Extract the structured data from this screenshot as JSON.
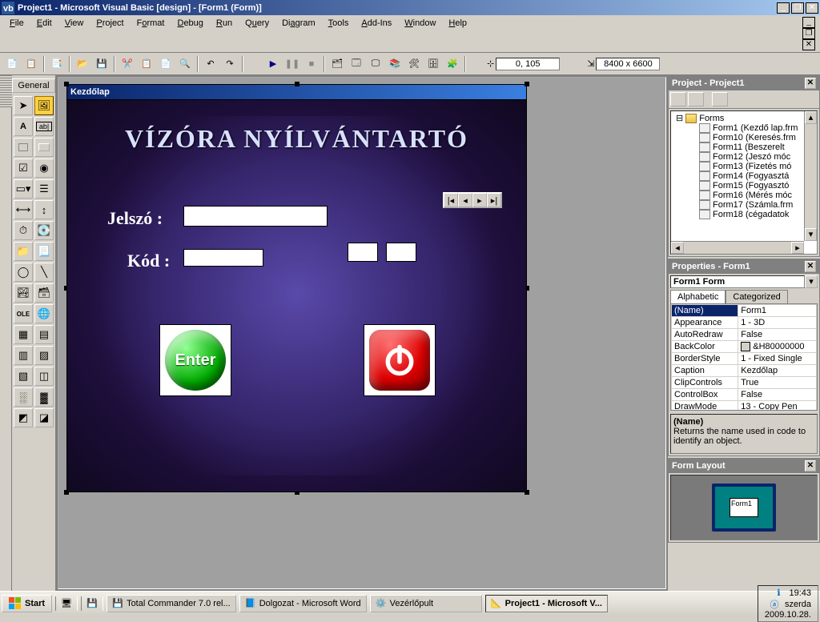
{
  "window": {
    "title": "Project1 - Microsoft Visual Basic [design] - [Form1 (Form)]"
  },
  "menubar": [
    "File",
    "Edit",
    "View",
    "Project",
    "Format",
    "Debug",
    "Run",
    "Query",
    "Diagram",
    "Tools",
    "Add-Ins",
    "Window",
    "Help"
  ],
  "coords": "0, 105",
  "dims": "8400 x 6600",
  "toolbox": {
    "header": "General"
  },
  "form": {
    "caption": "Kezdőlap",
    "title": "VÍZÓRA NYÍLVÁNTARTÓ",
    "label_password": "Jelszó :",
    "label_code": "Kód :",
    "enter": "Enter"
  },
  "project": {
    "title": "Project - Project1",
    "rootFolder": "Forms",
    "items": [
      "Form1 (Kezdő lap.frm",
      "Form10 (Keresés.frm",
      "Form11 (Beszerelt",
      "Form12 (Jeszó móc",
      "Form13 (Fizetés mó",
      "Form14 (Fogyasztá",
      "Form15 (Fogyasztó",
      "Form16 (Mérés móc",
      "Form17 (Számla.frm",
      "Form18 (cégadatok"
    ]
  },
  "properties": {
    "title": "Properties - Form1",
    "combo": "Form1",
    "comboType": "Form",
    "tabs": {
      "alpha": "Alphabetic",
      "cat": "Categorized"
    },
    "rows": [
      [
        "(Name)",
        "Form1"
      ],
      [
        "Appearance",
        "1 - 3D"
      ],
      [
        "AutoRedraw",
        "False"
      ],
      [
        "BackColor",
        "&H80000000"
      ],
      [
        "BorderStyle",
        "1 - Fixed Single"
      ],
      [
        "Caption",
        "Kezdőlap"
      ],
      [
        "ClipControls",
        "True"
      ],
      [
        "ControlBox",
        "False"
      ],
      [
        "DrawMode",
        "13 - Copy Pen"
      ]
    ],
    "descTitle": "(Name)",
    "descText": "Returns the name used in code to identify an object."
  },
  "layout": {
    "title": "Form Layout",
    "formLabel": "Form1"
  },
  "taskbar": {
    "start": "Start",
    "items": [
      "Total Commander 7.0 rel...",
      "Dolgozat - Microsoft Word",
      "Vezérlőpult",
      "Project1 - Microsoft V..."
    ],
    "time": "19:43",
    "day": "szerda",
    "date": "2009.10.28."
  }
}
